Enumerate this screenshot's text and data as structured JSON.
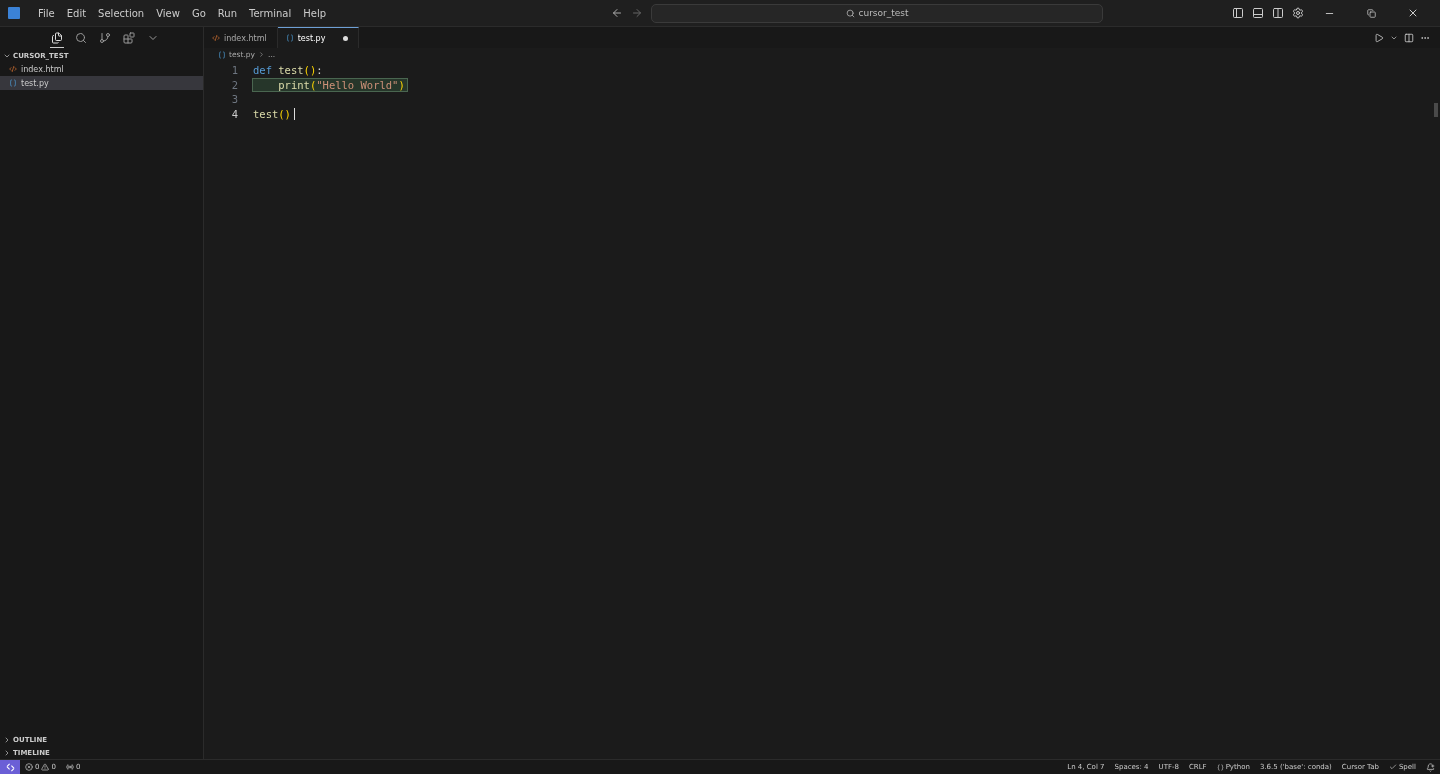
{
  "menu": [
    "File",
    "Edit",
    "Selection",
    "View",
    "Go",
    "Run",
    "Terminal",
    "Help"
  ],
  "command_center": {
    "value": "cursor_test"
  },
  "activity_bar": [
    {
      "kind": "explorer",
      "selected": true
    },
    {
      "kind": "search",
      "selected": false
    },
    {
      "kind": "source-control",
      "selected": false
    },
    {
      "kind": "extensions",
      "selected": false
    },
    {
      "kind": "more",
      "selected": false
    }
  ],
  "explorer": {
    "title": "CURSOR_TEST",
    "expanded": true,
    "files": [
      {
        "name": "index.html",
        "kind": "html",
        "selected": false
      },
      {
        "name": "test.py",
        "kind": "python",
        "selected": true
      }
    ]
  },
  "panels": [
    {
      "title": "OUTLINE",
      "expanded": false
    },
    {
      "title": "TIMELINE",
      "expanded": false
    }
  ],
  "tabs": [
    {
      "label": "index.html",
      "kind": "html",
      "selected": false,
      "modified": false
    },
    {
      "label": "test.py",
      "kind": "python",
      "selected": true,
      "modified": true
    }
  ],
  "breadcrumb": [
    "test.py",
    "..."
  ],
  "code": [
    {
      "number": "1",
      "current": false,
      "highlighted": false,
      "tokens": [
        {
          "text": "def ",
          "kind": "keyword"
        },
        {
          "text": "test",
          "kind": "function"
        },
        {
          "text": "()",
          "kind": "bracket"
        },
        {
          "text": ":",
          "kind": "plain"
        }
      ]
    },
    {
      "number": "2",
      "current": false,
      "highlighted": true,
      "indented": true,
      "tokens": [
        {
          "text": "print",
          "kind": "function"
        },
        {
          "text": "(",
          "kind": "bracket"
        },
        {
          "text": "\"Hello World\"",
          "kind": "string"
        },
        {
          "text": ")",
          "kind": "bracket"
        }
      ]
    },
    {
      "number": "3",
      "current": false,
      "highlighted": false
    },
    {
      "number": "4",
      "current": true,
      "highlighted": false,
      "tokens": [
        {
          "text": "test",
          "kind": "function"
        },
        {
          "text": "()",
          "kind": "bracket"
        }
      ]
    }
  ],
  "status_bar": {
    "errors": "0",
    "warnings": "0",
    "ports": "0",
    "items": [
      {
        "text": "Ln 4, Col 7",
        "kind": "text"
      },
      {
        "text": "Spaces: 4",
        "kind": "text"
      },
      {
        "text": "UTF-8",
        "kind": "text"
      },
      {
        "text": "CRLF",
        "kind": "text"
      },
      {
        "text": "Python",
        "kind": "language"
      },
      {
        "text": "3.6.5 ('base': conda)",
        "kind": "text"
      },
      {
        "text": "Cursor Tab",
        "kind": "text"
      },
      {
        "text": "Spell",
        "kind": "check"
      }
    ]
  }
}
